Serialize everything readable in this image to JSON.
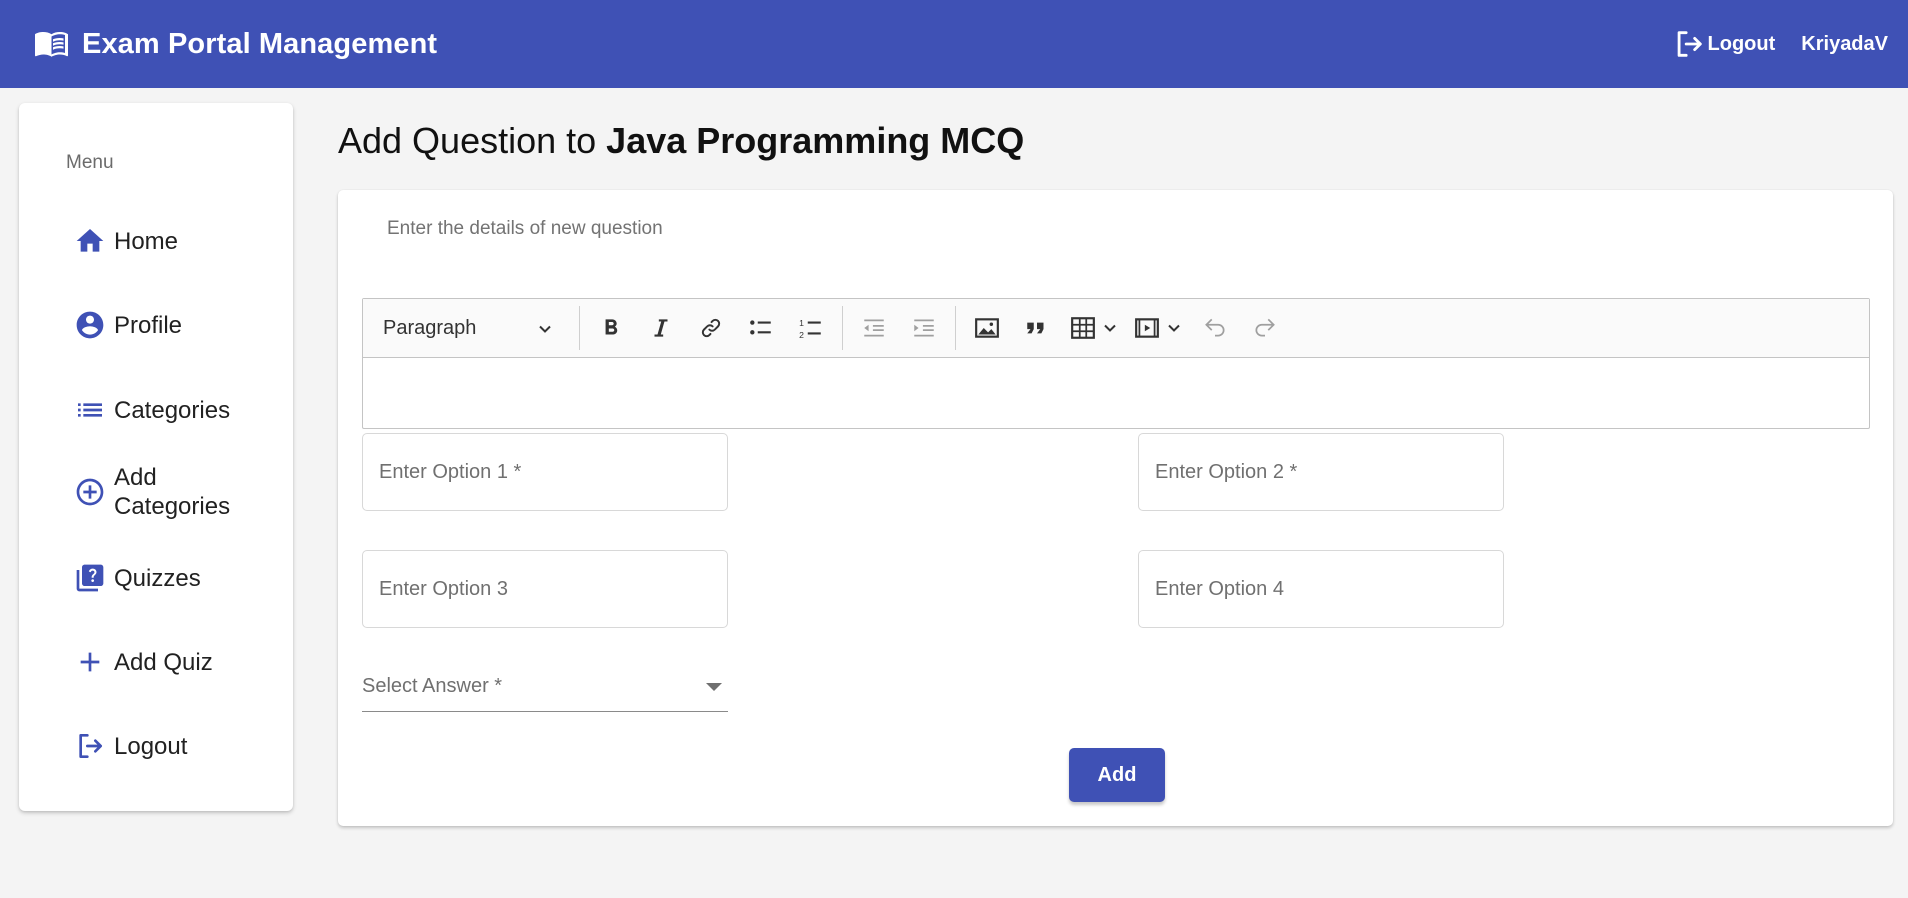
{
  "app": {
    "title": "Exam Portal Management",
    "brand_icon": "menu-book-icon",
    "accent_color": "#3f51b5"
  },
  "header": {
    "logout_label": "Logout",
    "username": "KriyadaV"
  },
  "sidebar": {
    "menu_label": "Menu",
    "items": [
      {
        "label": "Home",
        "icon": "home-icon"
      },
      {
        "label": "Profile",
        "icon": "account-circle-icon"
      },
      {
        "label": "Categories",
        "icon": "list-icon"
      },
      {
        "label": "Add Categories",
        "icon": "add-circle-icon"
      },
      {
        "label": "Quizzes",
        "icon": "quiz-icon"
      },
      {
        "label": "Add Quiz",
        "icon": "add-icon"
      },
      {
        "label": "Logout",
        "icon": "logout-icon"
      }
    ]
  },
  "main": {
    "title_prefix": "Add Question to ",
    "quiz_name": "Java Programming MCQ",
    "subtitle": "Enter the details of new question",
    "editor": {
      "heading_value": "Paragraph",
      "content": ""
    },
    "options": [
      {
        "placeholder": "Enter Option 1 *",
        "value": ""
      },
      {
        "placeholder": "Enter Option 2 *",
        "value": ""
      },
      {
        "placeholder": "Enter Option 3",
        "value": ""
      },
      {
        "placeholder": "Enter Option 4",
        "value": ""
      }
    ],
    "answer_select": {
      "placeholder": "Select Answer *",
      "value": ""
    },
    "submit_label": "Add"
  }
}
